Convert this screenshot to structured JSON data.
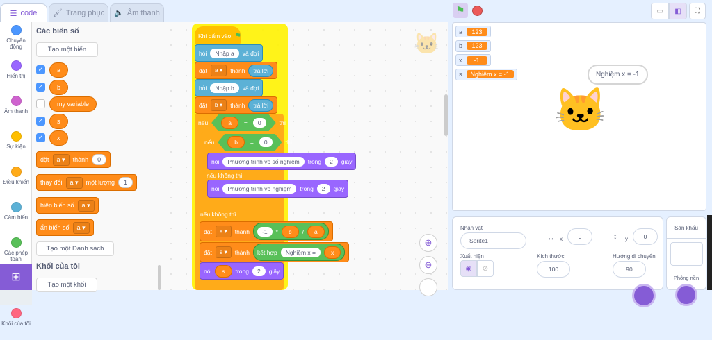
{
  "tabs": {
    "code": "code",
    "costumes": "Trang phục",
    "sounds": "Âm thanh"
  },
  "categories": [
    {
      "label": "Chuyển động",
      "color": "#4c97ff"
    },
    {
      "label": "Hiển thị",
      "color": "#9966ff"
    },
    {
      "label": "Âm thanh",
      "color": "#cf63cf"
    },
    {
      "label": "Sự kiện",
      "color": "#ffbf00"
    },
    {
      "label": "Điều khiển",
      "color": "#ffab19"
    },
    {
      "label": "Cảm biến",
      "color": "#5cb1d6"
    },
    {
      "label": "Các phép toán",
      "color": "#59c059"
    },
    {
      "label": "Các biến số",
      "color": "#ff8c1a"
    },
    {
      "label": "Khối của tôi",
      "color": "#ff6680"
    }
  ],
  "palette": {
    "heading": "Các biến số",
    "make_var": "Tạo một biến",
    "vars": [
      {
        "name": "a",
        "checked": true
      },
      {
        "name": "b",
        "checked": true
      },
      {
        "name": "my variable",
        "checked": false
      },
      {
        "name": "s",
        "checked": true
      },
      {
        "name": "x",
        "checked": true
      }
    ],
    "set": {
      "w1": "đặt",
      "var": "a",
      "w2": "thành",
      "val": "0"
    },
    "change": {
      "w1": "thay đổi",
      "var": "a",
      "w2": "một lượng",
      "val": "1"
    },
    "show": {
      "w1": "hiện biến số",
      "var": "a"
    },
    "hide": {
      "w1": "ẩn biến số",
      "var": "a"
    },
    "make_list": "Tạo một Danh sách",
    "my_blocks": "Khối của tôi",
    "make_block": "Tạo một khối"
  },
  "script": {
    "hat": "Khi bấm vào",
    "ask": "hỏi",
    "and_wait": "và đợi",
    "ask_a": "Nhập a",
    "ask_b": "Nhập b",
    "set": "đặt",
    "to": "thành",
    "answer": "trả lời",
    "if": "nếu",
    "then": "thì",
    "else": "nếu không thì",
    "say": "nói",
    "for": "trong",
    "secs": "giây",
    "two": "2",
    "eq": "=",
    "zero": "0",
    "minus1": "-1",
    "mul": "*",
    "div": "/",
    "msg_inf": "Phương trình vô số nghiệm",
    "msg_none": "Phương trình vô nghiệm",
    "join": "kết hợp",
    "join_text": "Nghiệm x =",
    "a": "a",
    "b": "b",
    "x": "x",
    "s": "s"
  },
  "stage": {
    "monitors": [
      {
        "name": "a",
        "value": "123"
      },
      {
        "name": "b",
        "value": "123"
      },
      {
        "name": "x",
        "value": "-1"
      },
      {
        "name": "s",
        "value": "Nghiệm x = -1"
      }
    ],
    "bubble": "Nghiệm x = -1"
  },
  "sprite_info": {
    "sprite_label": "Nhân vật",
    "sprite_name": "Sprite1",
    "x_label": "x",
    "x": "0",
    "y_label": "y",
    "y": "0",
    "show_label": "Xuất hiện",
    "size_label": "Kích thước",
    "size": "100",
    "dir_label": "Hướng di chuyển",
    "direction": "90"
  },
  "stage_panel": {
    "title": "Sân khấu",
    "backdrops": "Phông nền"
  }
}
